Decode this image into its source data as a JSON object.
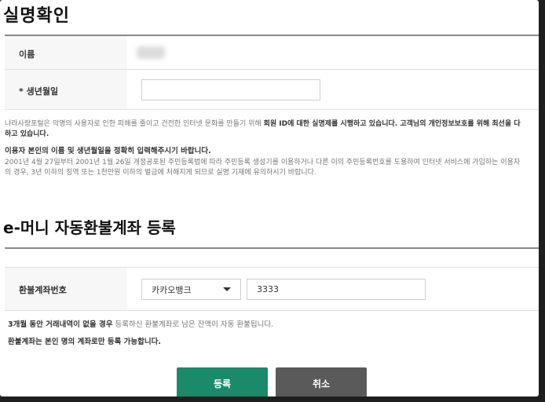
{
  "verify": {
    "title": "실명확인",
    "name_label": "이름",
    "birth_label": "* 생년월일",
    "birth_value": "",
    "notice_pre": "나라사랑포털은 악명의 사용자로 인한 피해를 줄이고 건전한 인터넷 문화를 만들기 위해 ",
    "notice_bold": "회원 ID에 대한 실명제를 시행하고 있습니다. 고객님의 개인정보보호를 위해 최선을 다",
    "notice_bold2": "하고 있습니다.",
    "accuracy_title": "이용자 본인의 이름 및 생년월일을 정확히 입력해주시기 바랍니다.",
    "legal_line1": "2001년 4월 27일부터 2001년 1월 26일 개정공포된 주민등록법에 따라 주민등록 생성기를 이용하거나 다른 이의 주민등록번호를 도용하여 인터넷 서비스에 가입하는 이용자",
    "legal_line2": "의 경우, 3년 이하의 징역 또는 1천만원 이하의 벌금에 처해지게 되므로 실명 기재에 유의하시기 바랍니다."
  },
  "refund": {
    "title": "e-머니 자동환불계좌 등록",
    "account_label": "환불계좌번호",
    "bank_selected": "카카오뱅크",
    "account_value": "3333",
    "note1_bold": "3개월 동안 거래내역이 없을 경우",
    "note1_rest": " 등록하신 환불계좌로 남은 잔액이 자동 환불됩니다.",
    "note2": "환불계좌는 본인 명의 계좌로만 등록 가능합니다."
  },
  "buttons": {
    "submit": "등록",
    "cancel": "취소"
  },
  "colors": {
    "primary": "#1b8a6b",
    "secondary": "#5a5a5a"
  }
}
